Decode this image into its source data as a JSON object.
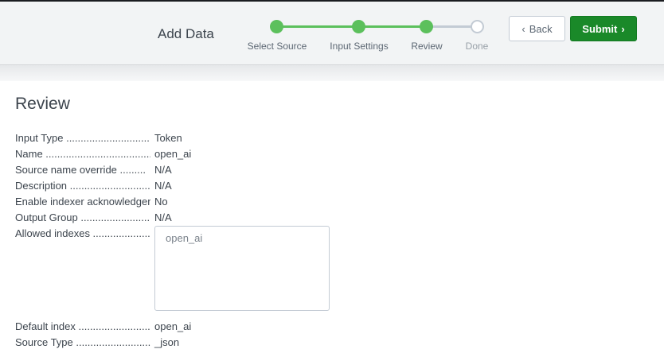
{
  "header": {
    "title": "Add Data",
    "steps": [
      {
        "label": "Select Source",
        "status": "complete"
      },
      {
        "label": "Input Settings",
        "status": "complete"
      },
      {
        "label": "Review",
        "status": "current"
      },
      {
        "label": "Done",
        "status": "pending"
      }
    ],
    "back_label": "Back",
    "submit_label": "Submit",
    "accent_color": "#5cc05c",
    "submit_color": "#1a8929"
  },
  "review": {
    "title": "Review",
    "fields": [
      {
        "label": "Input Type ..............................",
        "value": "Token"
      },
      {
        "label": "Name .......................................",
        "value": "open_ai"
      },
      {
        "label": "Source name override .........",
        "value": "N/A"
      },
      {
        "label": "Description .............................",
        "value": "N/A"
      },
      {
        "label": "Enable indexer acknowledgement",
        "value": "No"
      },
      {
        "label": "Output Group .........................",
        "value": "N/A"
      },
      {
        "label": "Allowed indexes ....................",
        "value": ""
      },
      {
        "label": "Default index ..........................",
        "value": "open_ai"
      },
      {
        "label": "Source Type ...........................",
        "value": "_json"
      }
    ],
    "allowed_indexes": [
      "open_ai"
    ]
  }
}
